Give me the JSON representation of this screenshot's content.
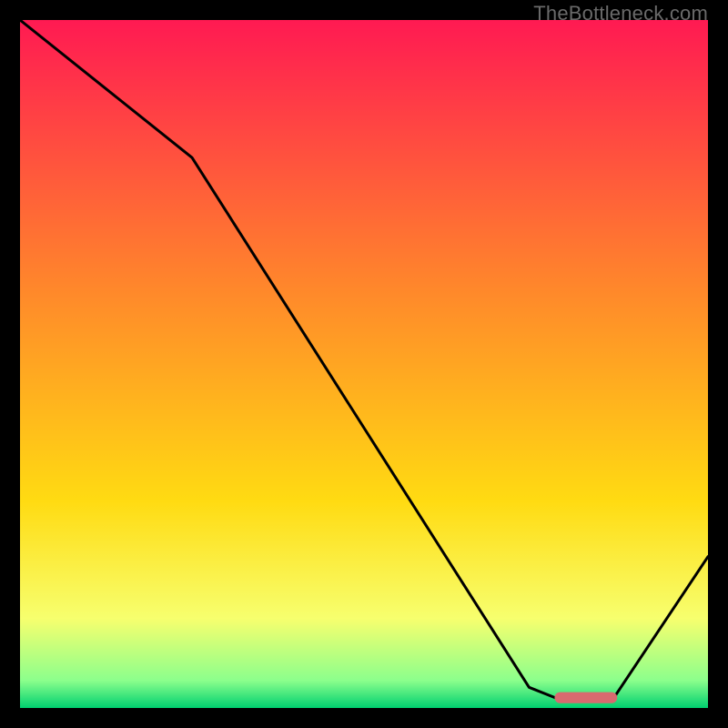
{
  "watermark": "TheBottleneck.com",
  "chart_data": {
    "type": "line",
    "title": "",
    "xlabel": "",
    "ylabel": "",
    "xlim": [
      0,
      100
    ],
    "ylim": [
      0,
      100
    ],
    "grid": false,
    "legend": false,
    "background_gradient": {
      "stops": [
        {
          "pos": 0.0,
          "color": "#ff1a52"
        },
        {
          "pos": 0.4,
          "color": "#ff8a2a"
        },
        {
          "pos": 0.7,
          "color": "#ffdb12"
        },
        {
          "pos": 0.87,
          "color": "#f7ff6e"
        },
        {
          "pos": 0.96,
          "color": "#8cff8c"
        },
        {
          "pos": 1.0,
          "color": "#00d070"
        }
      ]
    },
    "series": [
      {
        "name": "curve",
        "type": "line",
        "color": "#000000",
        "x": [
          0,
          25,
          74,
          79,
          86,
          100
        ],
        "values": [
          100,
          80,
          3,
          1,
          1,
          22
        ]
      },
      {
        "name": "marker",
        "type": "segment",
        "color": "#d96a6f",
        "x": [
          78.5,
          86
        ],
        "values": [
          1.5,
          1.5
        ],
        "thickness_pct": 1.6
      }
    ]
  }
}
